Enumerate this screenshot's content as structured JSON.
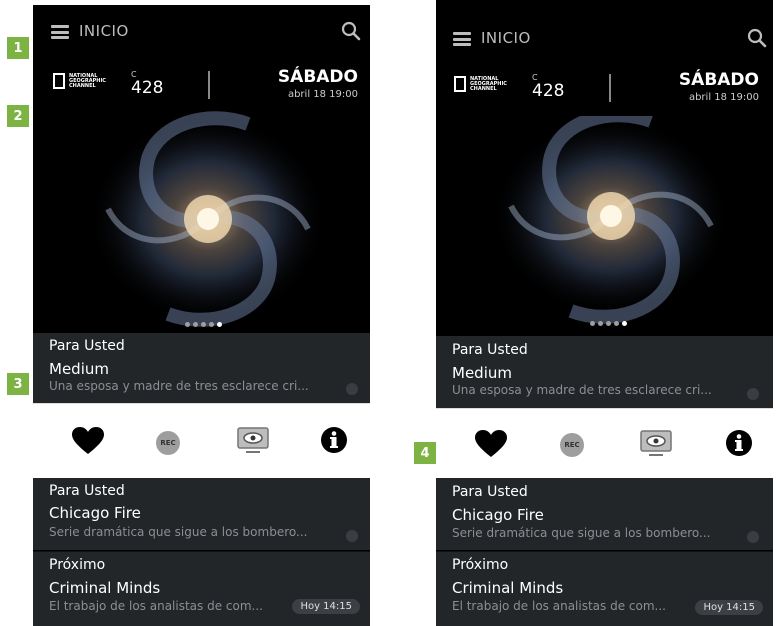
{
  "markers": [
    "1",
    "2",
    "3",
    "4"
  ],
  "header": {
    "title": "INICIO"
  },
  "channel": {
    "logo_text": "NATIONAL GEOGRAPHIC CHANNEL",
    "prefix": "C",
    "number": "428",
    "day": "SÁBADO",
    "datetime": "abril 18 19:00"
  },
  "carousel": {
    "count": 5,
    "active_index": 4
  },
  "featured": {
    "category": "Para Usted",
    "title": "Medium",
    "description": "Una esposa y madre de tres esclarece cri..."
  },
  "actions": {
    "favorite_icon": "heart-icon",
    "record_label": "REC",
    "watch_icon": "tv-eye-icon",
    "info_icon": "info-icon"
  },
  "list": [
    {
      "category": "Para Usted",
      "title": "Chicago Fire",
      "description": "Serie dramática que sigue a los bombero..."
    },
    {
      "category": "Próximo",
      "title": "Criminal Minds",
      "description": "El trabajo de los analistas de com...",
      "badge": "Hoy 14:15"
    }
  ],
  "colors": {
    "marker": "#7cb342",
    "card": "#232629",
    "background": "#000000"
  }
}
